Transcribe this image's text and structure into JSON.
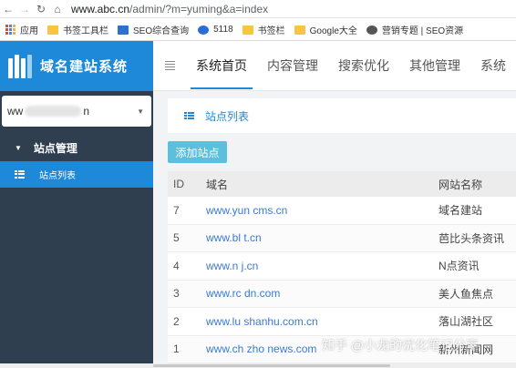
{
  "browser": {
    "url_host": "www.abc.cn",
    "url_path": "/admin/?m=yuming&a=index",
    "bookmarks": [
      {
        "label": "应用",
        "icon": "apps-grid-icon"
      },
      {
        "label": "书签工具栏",
        "icon": "folder-icon"
      },
      {
        "label": "SEO综合查询",
        "icon": "seo-tool-icon"
      },
      {
        "label": "5118",
        "icon": "5118-icon"
      },
      {
        "label": "书签栏",
        "icon": "folder-icon"
      },
      {
        "label": "Google大全",
        "icon": "folder-icon"
      },
      {
        "label": "营销专题 | SEO资源",
        "icon": "gear-icon"
      }
    ]
  },
  "sidebar": {
    "app_title": "域名建站系统",
    "site_select": {
      "prefix": "ww",
      "suffix": "n"
    },
    "group": "站点管理",
    "items": [
      {
        "label": "站点列表"
      }
    ]
  },
  "tabs": [
    "系统首页",
    "内容管理",
    "搜索优化",
    "其他管理",
    "系统"
  ],
  "panel": {
    "title": "站点列表",
    "add_button": "添加站点"
  },
  "table": {
    "headers": [
      "ID",
      "域名",
      "网站名称"
    ],
    "rows": [
      {
        "id": "7",
        "domain": "www.yun   cms.cn",
        "name": "域名建站"
      },
      {
        "id": "5",
        "domain": "www.bl   t.cn",
        "name": "芭比头条资讯"
      },
      {
        "id": "4",
        "domain": "www.n   j.cn",
        "name": "N点资讯"
      },
      {
        "id": "3",
        "domain": "www.rc   dn.com",
        "name": "美人鱼焦点"
      },
      {
        "id": "2",
        "domain": "www.lu   shanhu.com.cn",
        "name": "落山湖社区"
      },
      {
        "id": "1",
        "domain": "www.ch   zho   news.com",
        "name": "新州新闻网"
      }
    ]
  },
  "watermark": "知乎 @小龙的优化笔记分享",
  "colors": {
    "accent": "#1e88d9",
    "sidebar": "#2f3f50",
    "add_button": "#5bc0de",
    "link": "#3a7bd5"
  }
}
